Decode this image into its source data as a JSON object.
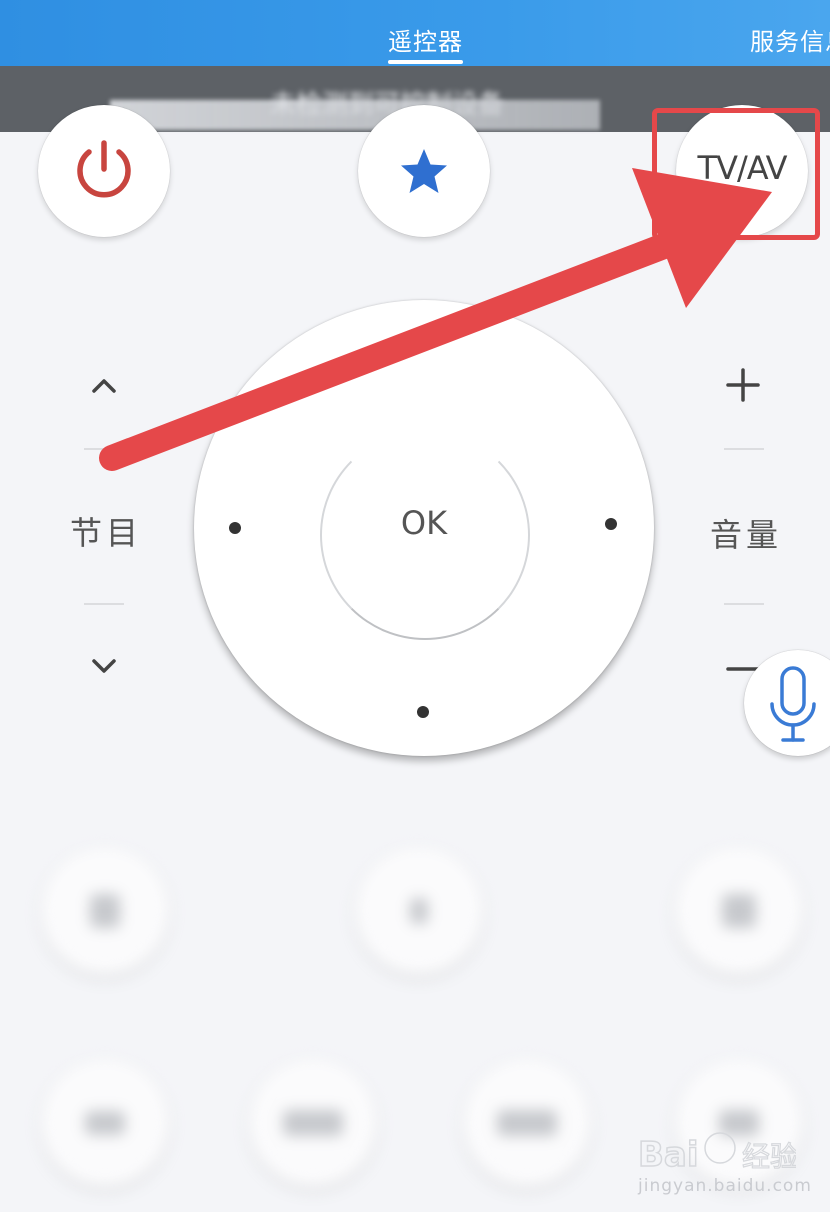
{
  "tabs": {
    "active_label": "遥控器",
    "other_label": "服务信息"
  },
  "notice": {
    "text": "未检测到可控制设备",
    "help_glyph": "?"
  },
  "top_buttons": {
    "power_icon": "power-icon",
    "favorite_icon": "star-icon",
    "tvav_label": "TV/AV"
  },
  "dpad": {
    "ok_label": "OK"
  },
  "channel": {
    "label": "节目",
    "up_icon": "chevron-up-icon",
    "down_icon": "chevron-down-icon"
  },
  "volume": {
    "label": "音量",
    "plus_glyph": "+",
    "minus_glyph": "−"
  },
  "voice": {
    "icon": "microphone-icon"
  },
  "colors": {
    "tabbar": "#2f8fe2",
    "notice_bg": "#5d6166",
    "power_red": "#c8453f",
    "star_blue": "#2f6fd0",
    "voice_blue": "#3a7bd5",
    "annotation_red": "#e5484a"
  },
  "watermark": {
    "logo_text": "Bai du 经验",
    "url": "jingyan.baidu.com"
  }
}
